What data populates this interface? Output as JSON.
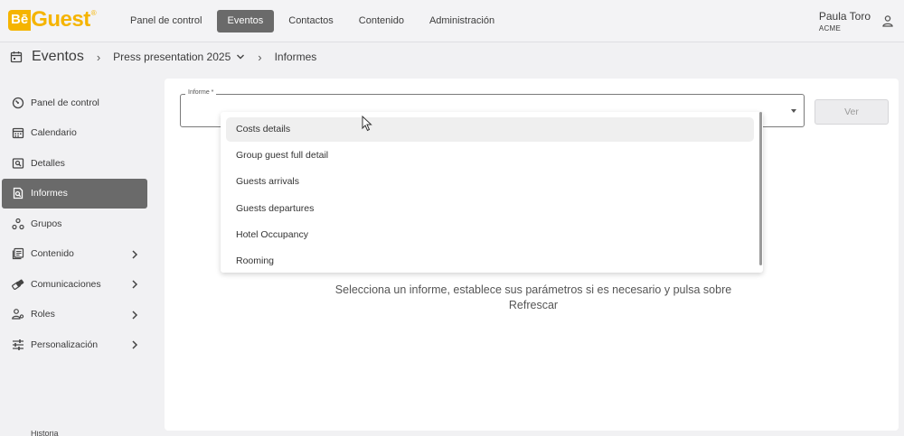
{
  "brand": {
    "be": "Bē",
    "guest": "Guest",
    "reg": "®",
    "color": "#f5b400"
  },
  "nav": {
    "items": [
      {
        "label": "Panel de control",
        "active": false
      },
      {
        "label": "Eventos",
        "active": true
      },
      {
        "label": "Contactos",
        "active": false
      },
      {
        "label": "Contenido",
        "active": false
      },
      {
        "label": "Administración",
        "active": false
      }
    ]
  },
  "user": {
    "name": "Paula Toro",
    "org": "ACME",
    "icon": "person-icon"
  },
  "breadcrumb": {
    "icon": "calendar-icon",
    "title": "Eventos",
    "event": "Press presentation 2025",
    "current": "Informes"
  },
  "sidebar": {
    "items": [
      {
        "label": "Panel de control",
        "icon": "dashboard-icon",
        "active": false,
        "chevron": false
      },
      {
        "label": "Calendario",
        "icon": "calendar-icon",
        "active": false,
        "chevron": false
      },
      {
        "label": "Detalles",
        "icon": "details-icon",
        "active": false,
        "chevron": false
      },
      {
        "label": "Informes",
        "icon": "report-icon",
        "active": true,
        "chevron": false
      },
      {
        "label": "Grupos",
        "icon": "groups-icon",
        "active": false,
        "chevron": false
      },
      {
        "label": "Contenido",
        "icon": "content-icon",
        "active": false,
        "chevron": true
      },
      {
        "label": "Comunicaciones",
        "icon": "communications-icon",
        "active": false,
        "chevron": true
      },
      {
        "label": "Roles",
        "icon": "roles-icon",
        "active": false,
        "chevron": true
      },
      {
        "label": "Personalización",
        "icon": "customization-icon",
        "active": false,
        "chevron": true
      }
    ]
  },
  "report": {
    "label": "Informe *",
    "value": "",
    "button": "Ver",
    "options": [
      "Costs details",
      "Group guest full detail",
      "Guests arrivals",
      "Guests departures",
      "Hotel Occupancy",
      "Rooming"
    ],
    "hovered": "Costs details"
  },
  "message": "Selecciona un informe, establece sus parámetros si es necesario y pulsa sobre Refrescar",
  "footer_fragment": "Historia"
}
